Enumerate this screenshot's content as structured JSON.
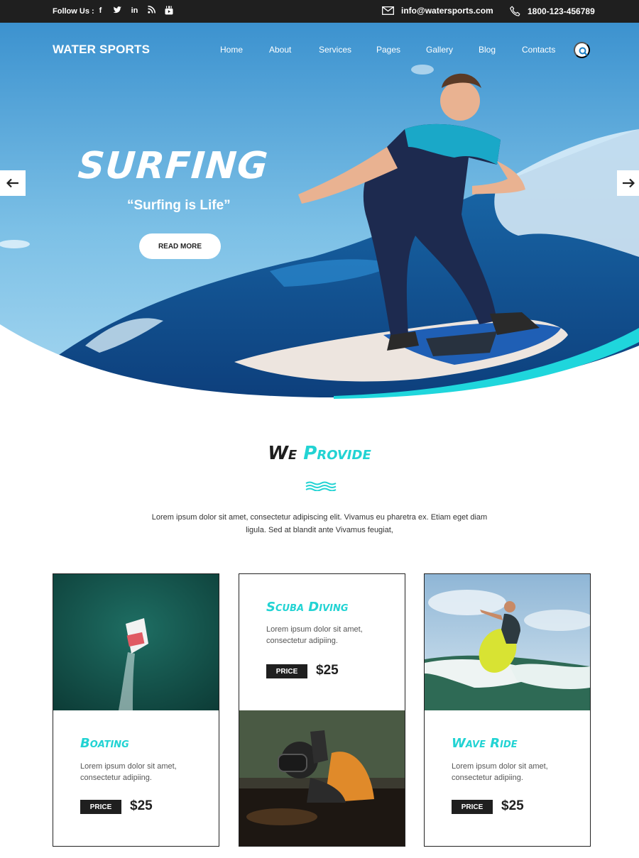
{
  "topbar": {
    "follow_label": "Follow Us :",
    "social": [
      "facebook-icon",
      "twitter-icon",
      "linkedin-icon",
      "rss-icon",
      "youtube-icon"
    ],
    "email": "info@watersports.com",
    "phone": "1800-123-456789"
  },
  "header": {
    "brand": "WATER SPORTS",
    "nav": [
      "Home",
      "About",
      "Services",
      "Pages",
      "Gallery",
      "Blog",
      "Contacts"
    ]
  },
  "hero": {
    "title": "SURFING",
    "subtitle": "“Surfing is Life”",
    "button": "READ MORE"
  },
  "provide": {
    "title_part1": "We",
    "title_part2": "Provide",
    "intro": "Lorem ipsum dolor sit amet, consectetur adipiscing elit. Vivamus eu pharetra ex. Etiam eget diam ligula. Sed at blandit ante Vivamus feugiat,"
  },
  "cards": [
    {
      "name": "Boating",
      "desc": "Lorem ipsum dolor sit amet, consectetur adipiing.",
      "price_label": "PRICE",
      "price": "$25"
    },
    {
      "name": "Scuba Diving",
      "desc": "Lorem ipsum dolor sit amet, consectetur adipiing.",
      "price_label": "PRICE",
      "price": "$25"
    },
    {
      "name": "Wave Ride",
      "desc": "Lorem ipsum dolor sit amet, consectetur adipiing.",
      "price_label": "PRICE",
      "price": "$25"
    }
  ],
  "colors": {
    "accent": "#22d3d3",
    "dark": "#1f1f1f",
    "sky": "#4aa6dc"
  }
}
